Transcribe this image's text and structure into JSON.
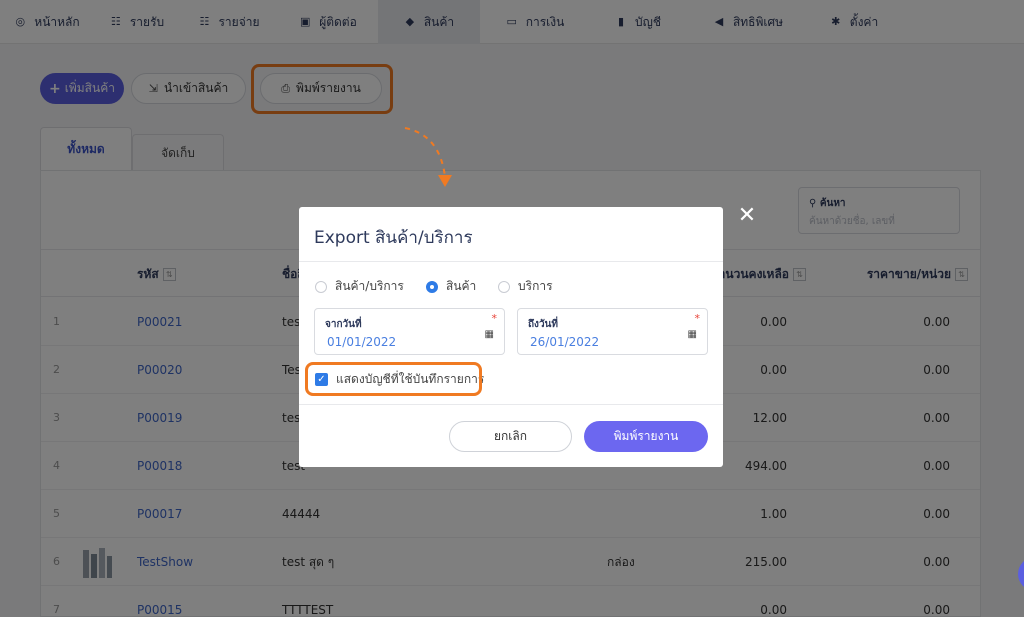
{
  "nav": [
    {
      "label": "หน้าหลัก",
      "icon": "dashboard-icon"
    },
    {
      "label": "รายรับ",
      "icon": "income-list-icon"
    },
    {
      "label": "รายจ่าย",
      "icon": "expense-list-icon"
    },
    {
      "label": "ผู้ติดต่อ",
      "icon": "contacts-icon"
    },
    {
      "label": "สินค้า",
      "icon": "box-icon"
    },
    {
      "label": "การเงิน",
      "icon": "money-icon"
    },
    {
      "label": "บัญชี",
      "icon": "book-icon"
    },
    {
      "label": "สิทธิพิเศษ",
      "icon": "megaphone-icon"
    },
    {
      "label": "ตั้งค่า",
      "icon": "gear-icon"
    }
  ],
  "toolbar": {
    "add_label": "เพิ่มสินค้า",
    "import_label": "นำเข้าสินค้า",
    "print_label": "พิมพ์รายงาน"
  },
  "tabs": [
    {
      "label": "ทั้งหมด"
    },
    {
      "label": "จัดเก็บ"
    }
  ],
  "search": {
    "label": "ค้นหา",
    "placeholder": "ค้นหาด้วยชื่อ, เลขที่"
  },
  "table": {
    "headers": {
      "code": "รหัส",
      "name": "ชื่อสินค้า",
      "stock": "จำนวนคงเหลือ",
      "price": "ราคาขาย/หน่วย"
    },
    "rows": [
      {
        "idx": "1",
        "code": "P00021",
        "name": "test",
        "unit": "",
        "stock": "0.00",
        "price": "0.00",
        "thumb": false
      },
      {
        "idx": "2",
        "code": "P00020",
        "name": "Test",
        "unit": "",
        "stock": "0.00",
        "price": "0.00",
        "thumb": false
      },
      {
        "idx": "3",
        "code": "P00019",
        "name": "test",
        "unit": "",
        "stock": "12.00",
        "price": "0.00",
        "thumb": false
      },
      {
        "idx": "4",
        "code": "P00018",
        "name": "test",
        "unit": "",
        "stock": "494.00",
        "price": "0.00",
        "thumb": false
      },
      {
        "idx": "5",
        "code": "P00017",
        "name": "44444",
        "unit": "",
        "stock": "1.00",
        "price": "0.00",
        "thumb": false
      },
      {
        "idx": "6",
        "code": "TestShow",
        "name": "test สุด ๆ",
        "unit": "กล่อง",
        "stock": "215.00",
        "price": "0.00",
        "thumb": true
      },
      {
        "idx": "7",
        "code": "P00015",
        "name": "TTTTEST",
        "unit": "",
        "stock": "0.00",
        "price": "0.00",
        "thumb": false
      }
    ]
  },
  "modal": {
    "title": "Export สินค้า/บริการ",
    "radio_options": [
      "สินค้า/บริการ",
      "สินค้า",
      "บริการ"
    ],
    "radio_selected": "สินค้า",
    "from_label": "จากวันที่",
    "from_value": "01/01/2022",
    "to_label": "ถึงวันที่",
    "to_value": "26/01/2022",
    "checkbox_label": "แสดงบัญชีที่ใช้บันทึกรายการ",
    "checkbox_checked": true,
    "cancel_label": "ยกเลิก",
    "confirm_label": "พิมพ์รายงาน"
  },
  "colors": {
    "accent": "#5b5fe0",
    "highlight": "#f07a22",
    "link": "#3e66c8"
  }
}
